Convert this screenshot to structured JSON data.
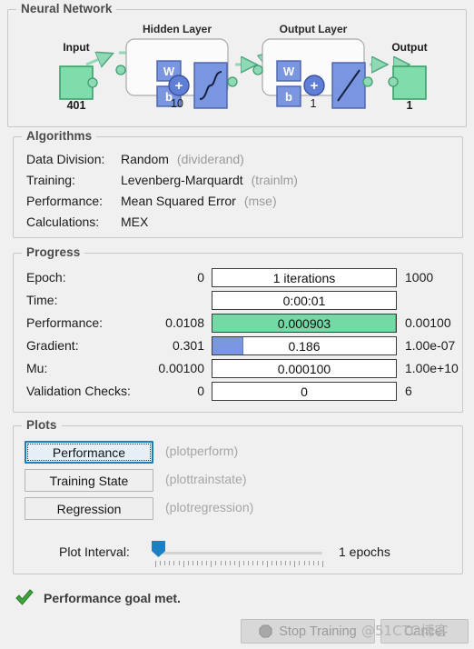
{
  "network": {
    "title": "Neural Network",
    "input_label": "Input",
    "input_size": "401",
    "hidden_layer_label": "Hidden Layer",
    "hidden_size": "10",
    "output_layer_label": "Output Layer",
    "output_layer_size": "1",
    "output_label": "Output",
    "output_size": "1",
    "weight_label": "W",
    "bias_label": "b",
    "sum_label": "+",
    "colors": {
      "io_block": "#7fddac",
      "io_block_border": "#3f9d6d",
      "layer_block": "#7b96e0",
      "layer_block_border": "#4a62ab",
      "link": "#8fd9b6"
    }
  },
  "algorithms": {
    "title": "Algorithms",
    "rows": [
      {
        "label": "Data Division:",
        "value": "Random",
        "fn": "(dividerand)"
      },
      {
        "label": "Training:",
        "value": "Levenberg-Marquardt",
        "fn": "(trainlm)"
      },
      {
        "label": "Performance:",
        "value": "Mean Squared Error",
        "fn": "(mse)"
      },
      {
        "label": "Calculations:",
        "value": "MEX",
        "fn": ""
      }
    ]
  },
  "progress": {
    "title": "Progress",
    "rows": [
      {
        "name": "Epoch:",
        "min": "0",
        "bar_text": "1 iterations",
        "max": "1000",
        "fill_pct": 0,
        "fill_color": "none"
      },
      {
        "name": "Time:",
        "min": "",
        "bar_text": "0:00:01",
        "max": "",
        "fill_pct": 0,
        "fill_color": "none"
      },
      {
        "name": "Performance:",
        "min": "0.0108",
        "bar_text": "0.000903",
        "max": "0.00100",
        "fill_pct": 100,
        "fill_color": "green"
      },
      {
        "name": "Gradient:",
        "min": "0.301",
        "bar_text": "0.186",
        "max": "1.00e-07",
        "fill_pct": 17,
        "fill_color": "blue"
      },
      {
        "name": "Mu:",
        "min": "0.00100",
        "bar_text": "0.000100",
        "max": "1.00e+10",
        "fill_pct": 0,
        "fill_color": "none"
      },
      {
        "name": "Validation Checks:",
        "min": "0",
        "bar_text": "0",
        "max": "6",
        "fill_pct": 0,
        "fill_color": "none"
      }
    ]
  },
  "plots": {
    "title": "Plots",
    "buttons": [
      {
        "label": "Performance",
        "fn": "(plotperform)",
        "focused": true
      },
      {
        "label": "Training State",
        "fn": "(plottrainstate)",
        "focused": false
      },
      {
        "label": "Regression",
        "fn": "(plotregression)",
        "focused": false
      }
    ],
    "slider": {
      "label": "Plot Interval:",
      "value_text": "1 epochs",
      "position_pct": 0
    }
  },
  "status": {
    "icon": "check-icon",
    "text": "Performance goal met."
  },
  "footer": {
    "stop_label": "Stop Training",
    "stop_icon": "stop-sign-icon",
    "cancel_label": "Cancel",
    "watermark": "@51CTO博客"
  }
}
